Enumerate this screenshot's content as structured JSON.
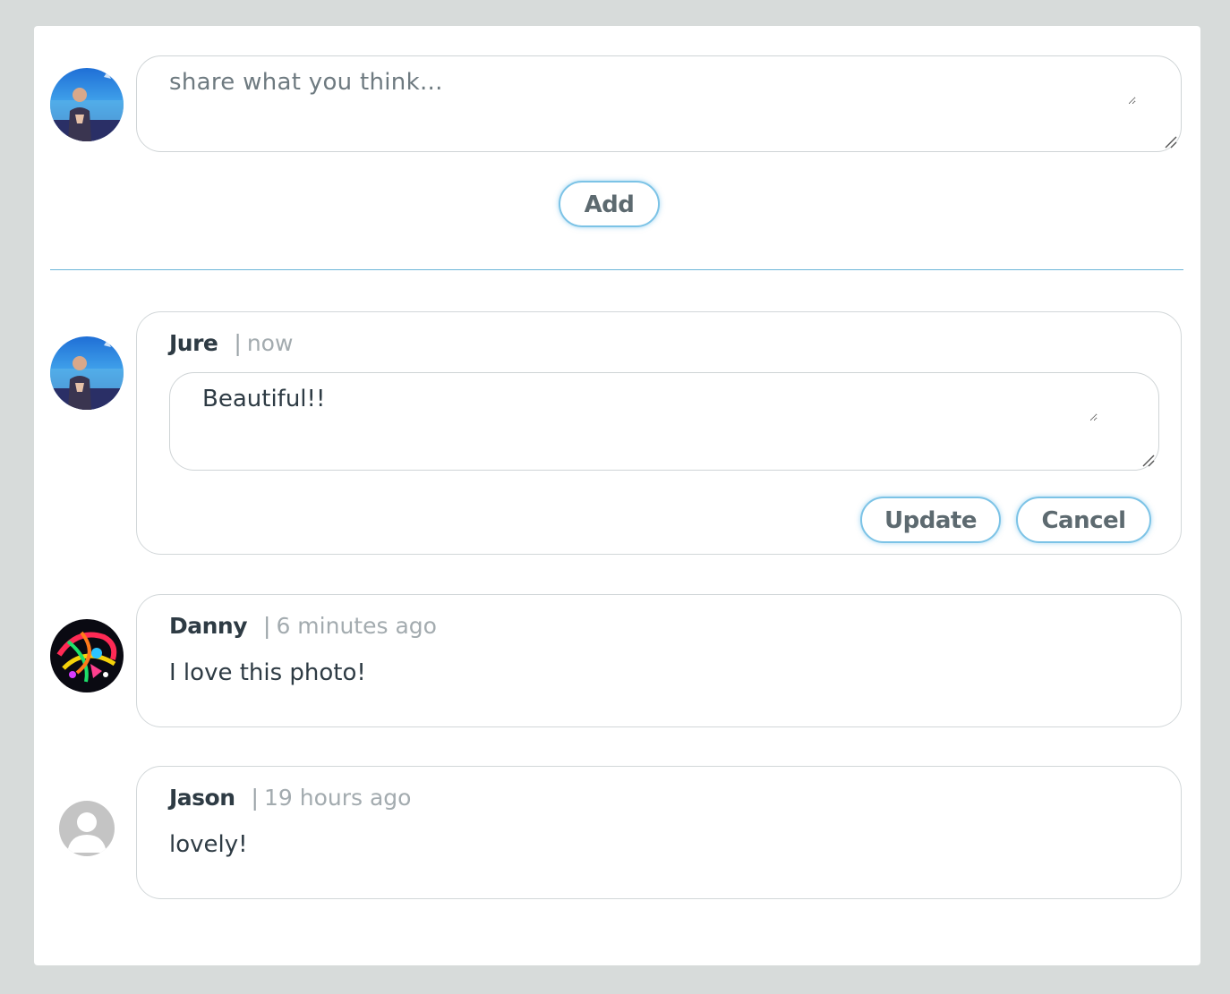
{
  "composer": {
    "placeholder": "share what you think...",
    "value": "",
    "add_label": "Add"
  },
  "comments": [
    {
      "author": "Jure",
      "separator": "|",
      "time": "now",
      "editing": true,
      "edit_value": "Beautiful!!",
      "update_label": "Update",
      "cancel_label": "Cancel",
      "avatar": "user-photo"
    },
    {
      "author": "Danny",
      "separator": "|",
      "time": "6 minutes ago",
      "text": "I love this photo!",
      "avatar": "abstract-art-photo"
    },
    {
      "author": "Jason",
      "separator": "|",
      "time": "19 hours ago",
      "text": "lovely!",
      "avatar": "default-avatar-icon"
    }
  ],
  "colors": {
    "background": "#d7dbda",
    "panel": "#ffffff",
    "accent": "#7cc3e6",
    "divider": "#6cb6d8",
    "text_dark": "#2e3b44",
    "text_muted": "#a3abaf"
  }
}
